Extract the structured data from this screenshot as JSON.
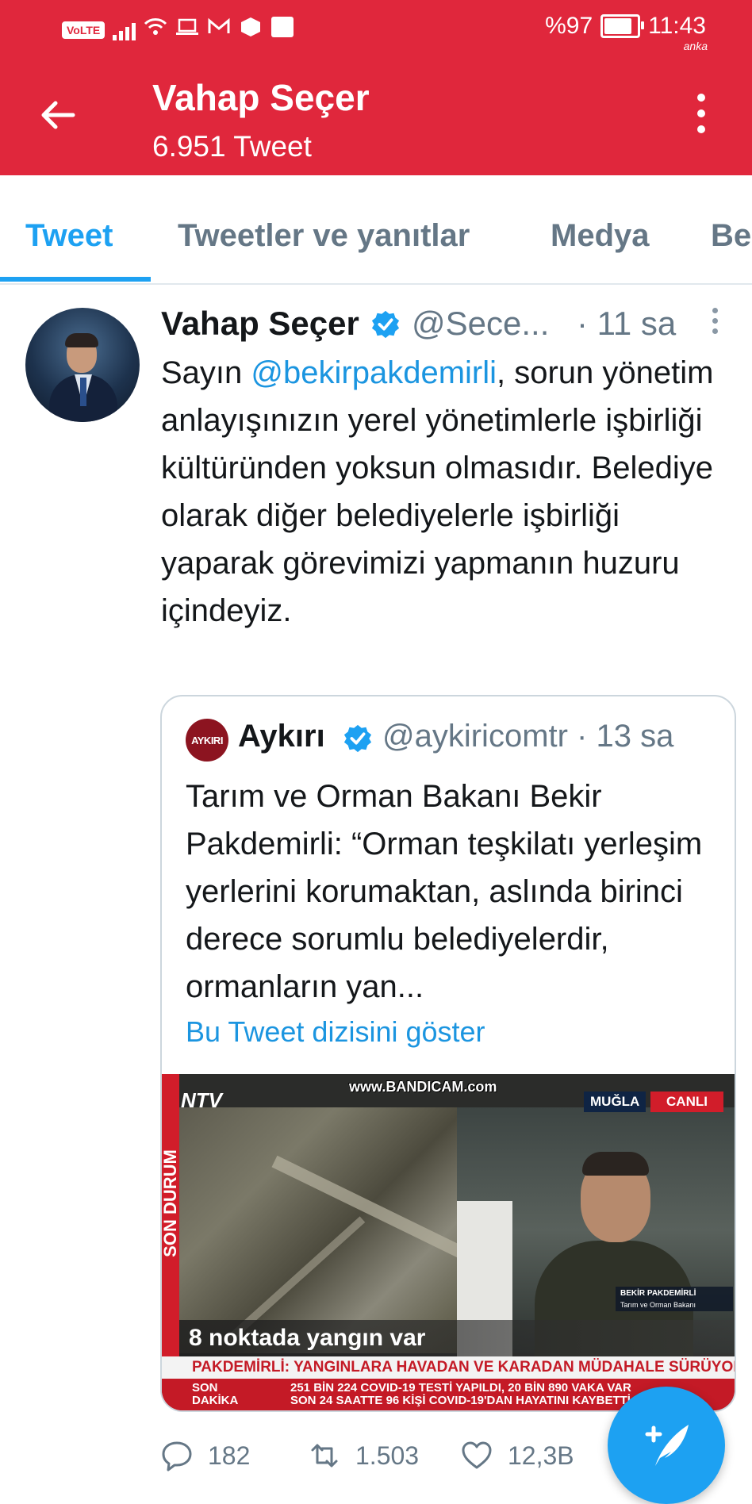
{
  "status_bar": {
    "network_badge": "VoLTE",
    "battery": "%97",
    "time": "11:43",
    "watermark": "anka"
  },
  "header": {
    "profile_name": "Vahap Seçer",
    "tweet_count": "6.951 Tweet"
  },
  "tabs": [
    {
      "label": "Tweet",
      "active": true
    },
    {
      "label": "Tweetler ve yanıtlar",
      "active": false
    },
    {
      "label": "Medya",
      "active": false
    },
    {
      "label": "Be",
      "active": false
    }
  ],
  "tweet": {
    "author_name": "Vahap Seçer",
    "handle": "@Sece...",
    "time": "· 11 sa",
    "text_prefix": "Sayın ",
    "mention": "@bekirpakdemirli",
    "text_suffix": ", sorun yönetim anlayışınızın yerel yönetimlerle işbirliği kültüründen yoksun olmasıdır. Belediye olarak diğer belediyelerle işbirliği yaparak görevimizi yapmanın huzuru içindeyiz.",
    "quoted": {
      "logo_text": "AYKIRI",
      "author_name": "Aykırı",
      "handle": "@aykiricomtr · 13 sa",
      "text": "Tarım ve Orman Bakanı Bekir Pakdemirli: “Orman teşkilatı yerleşim yerlerini korumaktan, aslında birinci derece sorumlu belediyelerdir, ormanların yan...",
      "thread_link": "Bu Tweet dizisini göster",
      "media": {
        "side_label": "SON DURUM",
        "channel": "NTV",
        "recorder_watermark": "www.BANDICAM.com",
        "location_tag": "MUĞLA",
        "live_tag": "CANLI",
        "nameplate_name": "BEKİR PAKDEMİRLİ",
        "nameplate_title": "Tarım ve Orman Bakanı",
        "headline": "8 noktada yangın var",
        "ticker_main": "PAKDEMİRLİ: YANGINLARA HAVADAN VE KARADAN MÜDAHALE SÜRÜYOR",
        "breaking_label": "SON DAKİKA",
        "ticker_line1": "251 BİN 224 COVID-19 TESTİ YAPILDI, 20 BİN 890 VAKA VAR",
        "ticker_line2": "SON 24 SAATTE 96 KİŞİ COVID-19'DAN HAYATINI KAYBETTİ"
      }
    },
    "replies": "182",
    "retweets": "1.503",
    "likes": "12,3B"
  },
  "colors": {
    "brand_red": "#e0273c",
    "twitter_blue": "#1da1f2",
    "link_blue": "#1b95e0",
    "muted_gray": "#657786"
  }
}
